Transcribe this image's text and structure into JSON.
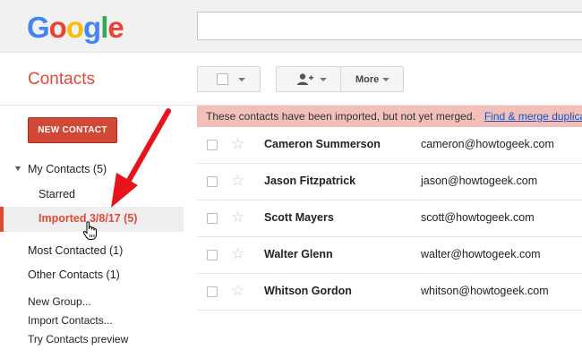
{
  "header": {
    "logo": [
      {
        "ch": "G",
        "color": "#4285f4"
      },
      {
        "ch": "o",
        "color": "#ea4335"
      },
      {
        "ch": "o",
        "color": "#fbbc05"
      },
      {
        "ch": "g",
        "color": "#4285f4"
      },
      {
        "ch": "l",
        "color": "#34a853"
      },
      {
        "ch": "e",
        "color": "#ea4335"
      }
    ],
    "search": {
      "value": "",
      "placeholder": ""
    }
  },
  "app": {
    "title": "Contacts",
    "accent": "#dd4b39"
  },
  "toolbar": {
    "select_icon": "checkbox-icon",
    "add_icon": "add-person-icon",
    "more_label": "More"
  },
  "sidebar": {
    "new_contact_label": "NEW CONTACT",
    "my_contacts": "My Contacts (5)",
    "starred": "Starred",
    "imported": "Imported 3/8/17 (5)",
    "most_contacted": "Most Contacted (1)",
    "other_contacts": "Other Contacts (1)",
    "new_group": "New Group...",
    "import_contacts": "Import Contacts...",
    "try_preview": "Try Contacts preview"
  },
  "notice": {
    "message": "These contacts have been imported, but not yet merged.",
    "link": "Find & merge duplicates"
  },
  "contacts": [
    {
      "name": "Cameron Summerson",
      "email": "cameron@howtogeek.com"
    },
    {
      "name": "Jason Fitzpatrick",
      "email": "jason@howtogeek.com"
    },
    {
      "name": "Scott Mayers",
      "email": "scott@howtogeek.com"
    },
    {
      "name": "Walter Glenn",
      "email": "walter@howtogeek.com"
    },
    {
      "name": "Whitson Gordon",
      "email": "whitson@howtogeek.com"
    }
  ],
  "annotation": {
    "arrow_color": "#e8141b",
    "icon": "hand-cursor-icon"
  }
}
